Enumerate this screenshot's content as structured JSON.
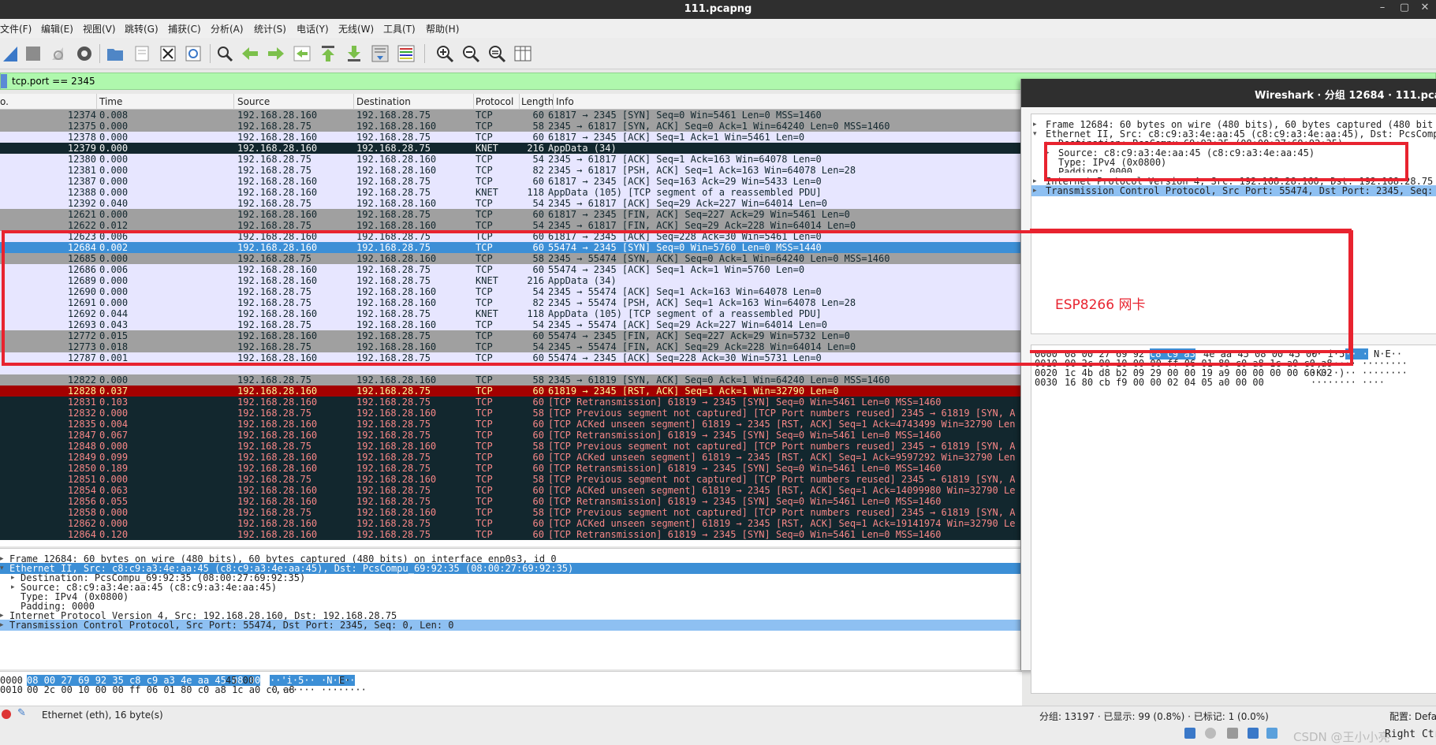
{
  "window": {
    "title": "111.pcapng"
  },
  "menu": [
    "文件(F)",
    "编辑(E)",
    "视图(V)",
    "跳转(G)",
    "捕获(C)",
    "分析(A)",
    "统计(S)",
    "电话(Y)",
    "无线(W)",
    "工具(T)",
    "帮助(H)"
  ],
  "filter": {
    "text": "tcp.port == 2345"
  },
  "columns": [
    "o.",
    "Time",
    "Source",
    "Destination",
    "Protocol",
    "Length",
    "Info"
  ],
  "colors": {
    "tcp": "#e7e6ff",
    "syn_fin": "#a0a0a0",
    "selected": "#3c8fd6",
    "knet": "#12272e",
    "error": "#a40000",
    "filter_ok": "#aff8ad",
    "annotation": "#e8232f"
  },
  "packets": [
    {
      "no": "12374",
      "time": "0.008",
      "src": "192.168.28.160",
      "dst": "192.168.28.75",
      "proto": "TCP",
      "len": "60",
      "info": "61817 → 2345 [SYN] Seq=0 Win=5461 Len=0 MSS=1460",
      "style": "gray"
    },
    {
      "no": "12375",
      "time": "0.000",
      "src": "192.168.28.75",
      "dst": "192.168.28.160",
      "proto": "TCP",
      "len": "58",
      "info": "2345 → 61817 [SYN, ACK] Seq=0 Ack=1 Win=64240 Len=0 MSS=1460",
      "style": "gray"
    },
    {
      "no": "12378",
      "time": "0.000",
      "src": "192.168.28.160",
      "dst": "192.168.28.75",
      "proto": "TCP",
      "len": "60",
      "info": "61817 → 2345 [ACK] Seq=1 Ack=1 Win=5461 Len=0",
      "style": "tcp"
    },
    {
      "no": "12379",
      "time": "0.000",
      "src": "192.168.28.160",
      "dst": "192.168.28.75",
      "proto": "KNET",
      "len": "216",
      "info": "AppData (34)",
      "style": "dark"
    },
    {
      "no": "12380",
      "time": "0.000",
      "src": "192.168.28.75",
      "dst": "192.168.28.160",
      "proto": "TCP",
      "len": "54",
      "info": "2345 → 61817 [ACK] Seq=1 Ack=163 Win=64078 Len=0",
      "style": "tcp"
    },
    {
      "no": "12381",
      "time": "0.000",
      "src": "192.168.28.75",
      "dst": "192.168.28.160",
      "proto": "TCP",
      "len": "82",
      "info": "2345 → 61817 [PSH, ACK] Seq=1 Ack=163 Win=64078 Len=28",
      "style": "tcp"
    },
    {
      "no": "12387",
      "time": "0.000",
      "src": "192.168.28.160",
      "dst": "192.168.28.75",
      "proto": "TCP",
      "len": "60",
      "info": "61817 → 2345 [ACK] Seq=163 Ack=29 Win=5433 Len=0",
      "style": "tcp"
    },
    {
      "no": "12388",
      "time": "0.000",
      "src": "192.168.28.160",
      "dst": "192.168.28.75",
      "proto": "KNET",
      "len": "118",
      "info": "AppData (105) [TCP segment of a reassembled PDU]",
      "style": "tcp"
    },
    {
      "no": "12392",
      "time": "0.040",
      "src": "192.168.28.75",
      "dst": "192.168.28.160",
      "proto": "TCP",
      "len": "54",
      "info": "2345 → 61817 [ACK] Seq=29 Ack=227 Win=64014 Len=0",
      "style": "tcp"
    },
    {
      "no": "12621",
      "time": "0.000",
      "src": "192.168.28.160",
      "dst": "192.168.28.75",
      "proto": "TCP",
      "len": "60",
      "info": "61817 → 2345 [FIN, ACK] Seq=227 Ack=29 Win=5461 Len=0",
      "style": "gray"
    },
    {
      "no": "12622",
      "time": "0.012",
      "src": "192.168.28.75",
      "dst": "192.168.28.160",
      "proto": "TCP",
      "len": "54",
      "info": "2345 → 61817 [FIN, ACK] Seq=29 Ack=228 Win=64014 Len=0",
      "style": "gray"
    },
    {
      "no": "12623",
      "time": "0.006",
      "src": "192.168.28.160",
      "dst": "192.168.28.75",
      "proto": "TCP",
      "len": "60",
      "info": "61817 → 2345 [ACK] Seq=228 Ack=30 Win=5461 Len=0",
      "style": "tcp"
    },
    {
      "no": "12684",
      "time": "0.002",
      "src": "192.168.28.160",
      "dst": "192.168.28.75",
      "proto": "TCP",
      "len": "60",
      "info": "55474 → 2345 [SYN] Seq=0 Win=5760 Len=0 MSS=1440",
      "style": "selected"
    },
    {
      "no": "12685",
      "time": "0.000",
      "src": "192.168.28.75",
      "dst": "192.168.28.160",
      "proto": "TCP",
      "len": "58",
      "info": "2345 → 55474 [SYN, ACK] Seq=0 Ack=1 Win=64240 Len=0 MSS=1460",
      "style": "gray"
    },
    {
      "no": "12686",
      "time": "0.006",
      "src": "192.168.28.160",
      "dst": "192.168.28.75",
      "proto": "TCP",
      "len": "60",
      "info": "55474 → 2345 [ACK] Seq=1 Ack=1 Win=5760 Len=0",
      "style": "tcp"
    },
    {
      "no": "12689",
      "time": "0.000",
      "src": "192.168.28.160",
      "dst": "192.168.28.75",
      "proto": "KNET",
      "len": "216",
      "info": "AppData (34)",
      "style": "tcp"
    },
    {
      "no": "12690",
      "time": "0.000",
      "src": "192.168.28.75",
      "dst": "192.168.28.160",
      "proto": "TCP",
      "len": "54",
      "info": "2345 → 55474 [ACK] Seq=1 Ack=163 Win=64078 Len=0",
      "style": "tcp"
    },
    {
      "no": "12691",
      "time": "0.000",
      "src": "192.168.28.75",
      "dst": "192.168.28.160",
      "proto": "TCP",
      "len": "82",
      "info": "2345 → 55474 [PSH, ACK] Seq=1 Ack=163 Win=64078 Len=28",
      "style": "tcp"
    },
    {
      "no": "12692",
      "time": "0.044",
      "src": "192.168.28.160",
      "dst": "192.168.28.75",
      "proto": "KNET",
      "len": "118",
      "info": "AppData (105) [TCP segment of a reassembled PDU]",
      "style": "tcp"
    },
    {
      "no": "12693",
      "time": "0.043",
      "src": "192.168.28.75",
      "dst": "192.168.28.160",
      "proto": "TCP",
      "len": "54",
      "info": "2345 → 55474 [ACK] Seq=29 Ack=227 Win=64014 Len=0",
      "style": "tcp"
    },
    {
      "no": "12772",
      "time": "0.015",
      "src": "192.168.28.160",
      "dst": "192.168.28.75",
      "proto": "TCP",
      "len": "60",
      "info": "55474 → 2345 [FIN, ACK] Seq=227 Ack=29 Win=5732 Len=0",
      "style": "gray"
    },
    {
      "no": "12773",
      "time": "0.018",
      "src": "192.168.28.75",
      "dst": "192.168.28.160",
      "proto": "TCP",
      "len": "54",
      "info": "2345 → 55474 [FIN, ACK] Seq=29 Ack=228 Win=64014 Len=0",
      "style": "gray"
    },
    {
      "no": "12787",
      "time": "0.001",
      "src": "192.168.28.160",
      "dst": "192.168.28.75",
      "proto": "TCP",
      "len": "60",
      "info": "55474 → 2345 [ACK] Seq=228 Ack=30 Win=5731 Len=0",
      "style": "tcp"
    },
    {
      "no": "",
      "time": "",
      "src": "",
      "dst": "",
      "proto": "",
      "len": "",
      "info": "",
      "style": "tcp"
    },
    {
      "no": "12822",
      "time": "0.000",
      "src": "192.168.28.75",
      "dst": "192.168.28.160",
      "proto": "TCP",
      "len": "58",
      "info": "2345 → 61819 [SYN, ACK] Seq=0 Ack=1 Win=64240 Len=0 MSS=1460",
      "style": "gray"
    },
    {
      "no": "12828",
      "time": "0.037",
      "src": "192.168.28.160",
      "dst": "192.168.28.75",
      "proto": "TCP",
      "len": "60",
      "info": "61819 → 2345 [RST, ACK] Seq=1 Ack=1 Win=32790 Len=0",
      "style": "error"
    },
    {
      "no": "12831",
      "time": "0.103",
      "src": "192.168.28.160",
      "dst": "192.168.28.75",
      "proto": "TCP",
      "len": "60",
      "info": "[TCP Retransmission] 61819 → 2345 [SYN] Seq=0 Win=5461 Len=0 MSS=1460",
      "style": "dark"
    },
    {
      "no": "12832",
      "time": "0.000",
      "src": "192.168.28.75",
      "dst": "192.168.28.160",
      "proto": "TCP",
      "len": "58",
      "info": "[TCP Previous segment not captured] [TCP Port numbers reused] 2345 → 61819 [SYN, A",
      "style": "dark"
    },
    {
      "no": "12835",
      "time": "0.004",
      "src": "192.168.28.160",
      "dst": "192.168.28.75",
      "proto": "TCP",
      "len": "60",
      "info": "[TCP ACKed unseen segment] 61819 → 2345 [RST, ACK] Seq=1 Ack=4743499 Win=32790 Len",
      "style": "dark"
    },
    {
      "no": "12847",
      "time": "0.067",
      "src": "192.168.28.160",
      "dst": "192.168.28.75",
      "proto": "TCP",
      "len": "60",
      "info": "[TCP Retransmission] 61819 → 2345 [SYN] Seq=0 Win=5461 Len=0 MSS=1460",
      "style": "dark"
    },
    {
      "no": "12848",
      "time": "0.000",
      "src": "192.168.28.75",
      "dst": "192.168.28.160",
      "proto": "TCP",
      "len": "58",
      "info": "[TCP Previous segment not captured] [TCP Port numbers reused] 2345 → 61819 [SYN, A",
      "style": "dark"
    },
    {
      "no": "12849",
      "time": "0.099",
      "src": "192.168.28.160",
      "dst": "192.168.28.75",
      "proto": "TCP",
      "len": "60",
      "info": "[TCP ACKed unseen segment] 61819 → 2345 [RST, ACK] Seq=1 Ack=9597292 Win=32790 Len",
      "style": "dark"
    },
    {
      "no": "12850",
      "time": "0.189",
      "src": "192.168.28.160",
      "dst": "192.168.28.75",
      "proto": "TCP",
      "len": "60",
      "info": "[TCP Retransmission] 61819 → 2345 [SYN] Seq=0 Win=5461 Len=0 MSS=1460",
      "style": "dark"
    },
    {
      "no": "12851",
      "time": "0.000",
      "src": "192.168.28.75",
      "dst": "192.168.28.160",
      "proto": "TCP",
      "len": "58",
      "info": "[TCP Previous segment not captured] [TCP Port numbers reused] 2345 → 61819 [SYN, A",
      "style": "dark"
    },
    {
      "no": "12854",
      "time": "0.063",
      "src": "192.168.28.160",
      "dst": "192.168.28.75",
      "proto": "TCP",
      "len": "60",
      "info": "[TCP ACKed unseen segment] 61819 → 2345 [RST, ACK] Seq=1 Ack=14099980 Win=32790 Le",
      "style": "dark"
    },
    {
      "no": "12856",
      "time": "0.055",
      "src": "192.168.28.160",
      "dst": "192.168.28.75",
      "proto": "TCP",
      "len": "60",
      "info": "[TCP Retransmission] 61819 → 2345 [SYN] Seq=0 Win=5461 Len=0 MSS=1460",
      "style": "dark"
    },
    {
      "no": "12858",
      "time": "0.000",
      "src": "192.168.28.75",
      "dst": "192.168.28.160",
      "proto": "TCP",
      "len": "58",
      "info": "[TCP Previous segment not captured] [TCP Port numbers reused] 2345 → 61819 [SYN, A",
      "style": "dark"
    },
    {
      "no": "12862",
      "time": "0.000",
      "src": "192.168.28.160",
      "dst": "192.168.28.75",
      "proto": "TCP",
      "len": "60",
      "info": "[TCP ACKed unseen segment] 61819 → 2345 [RST, ACK] Seq=1 Ack=19141974 Win=32790 Le",
      "style": "dark"
    },
    {
      "no": "12864",
      "time": "0.120",
      "src": "192.168.28.160",
      "dst": "192.168.28.75",
      "proto": "TCP",
      "len": "60",
      "info": "[TCP Retransmission] 61819 → 2345 [SYN] Seq=0 Win=5461 Len=0 MSS=1460",
      "style": "dark"
    }
  ],
  "details": [
    {
      "text": "Frame 12684: 60 bytes on wire (480 bits), 60 bytes captured (480 bits) on interface enp0s3, id 0",
      "indent": 0,
      "arrow": "▸",
      "style": ""
    },
    {
      "text": "Ethernet II, Src: c8:c9:a3:4e:aa:45 (c8:c9:a3:4e:aa:45), Dst: PcsCompu_69:92:35 (08:00:27:69:92:35)",
      "indent": 0,
      "arrow": "▾",
      "style": "selected"
    },
    {
      "text": "Destination: PcsCompu_69:92:35 (08:00:27:69:92:35)",
      "indent": 1,
      "arrow": "▸",
      "style": ""
    },
    {
      "text": "Source: c8:c9:a3:4e:aa:45 (c8:c9:a3:4e:aa:45)",
      "indent": 1,
      "arrow": "▸",
      "style": ""
    },
    {
      "text": "Type: IPv4 (0x0800)",
      "indent": 1,
      "arrow": "",
      "style": ""
    },
    {
      "text": "Padding: 0000",
      "indent": 1,
      "arrow": "",
      "style": ""
    },
    {
      "text": "Internet Protocol Version 4, Src: 192.168.28.160, Dst: 192.168.28.75",
      "indent": 0,
      "arrow": "▸",
      "style": ""
    },
    {
      "text": "Transmission Control Protocol, Src Port: 55474, Dst Port: 2345, Seq: 0, Len: 0",
      "indent": 0,
      "arrow": "▸",
      "style": "light"
    }
  ],
  "bytes": [
    {
      "off": "0000",
      "hex_sel": "08 00 27 69 92 35 c8 c9  a3 4e aa 45 08 00",
      "hex_rest": " 45 00",
      "ascii_sel": "··'i·5·· ·N·E··",
      "ascii_rest": "E·"
    },
    {
      "off": "0010",
      "hex_sel": "",
      "hex_rest": "00 2c 00 10 00 00 ff 06  01 80 c0 a8 1c a0 c0 a8",
      "ascii_sel": "",
      "ascii_rest": "·,······ ········"
    }
  ],
  "status": {
    "left": "Ethernet (eth), 16 byte(s)",
    "right": "分组: 13197 · 已显示: 99 (0.8%) · 已标记: 1 (0.0%)",
    "profile": "配置: Defau",
    "watermark": "CSDN @王小小亮",
    "right_ctrl": "Right Ctr"
  },
  "popup": {
    "title": "Wireshark · 分组 12684 · 111.pcap",
    "tree": [
      {
        "text": "Frame 12684: 60 bytes on wire (480 bits), 60 bytes captured (480 bit",
        "indent": 0,
        "arrow": "▸",
        "style": ""
      },
      {
        "text": "Ethernet II, Src: c8:c9:a3:4e:aa:45 (c8:c9:a3:4e:aa:45), Dst: PcsComp",
        "indent": 0,
        "arrow": "▾",
        "style": ""
      },
      {
        "text": "Destination: PcsCompu_69:92:35 (08:00:27:69:92:35)",
        "indent": 1,
        "arrow": "▸",
        "style": "clip"
      },
      {
        "text": "Source: c8:c9:a3:4e:aa:45 (c8:c9:a3:4e:aa:45)",
        "indent": 1,
        "arrow": "▸",
        "style": ""
      },
      {
        "text": "Type: IPv4 (0x0800)",
        "indent": 1,
        "arrow": "",
        "style": ""
      },
      {
        "text": "Padding: 0000",
        "indent": 1,
        "arrow": "",
        "style": "clip"
      },
      {
        "text": "Internet Protocol Version 4, Src: 192.168.28.160, Dst: 192.168.28.75",
        "indent": 0,
        "arrow": "▸",
        "style": ""
      },
      {
        "text": "Transmission Control Protocol, Src Port: 55474, Dst Port: 2345, Seq:",
        "indent": 0,
        "arrow": "▸",
        "style": "light"
      }
    ],
    "hex": [
      {
        "off": "0000",
        "pre": "08 00 27 69 92 35 ",
        "sel": "c8 c9  a3",
        "post": " 4e aa 45 08 00 45 00",
        "ascii_pre": "··'i·5",
        "ascii_sel": "·· ·",
        "ascii_post": "N·E··"
      },
      {
        "off": "0010",
        "pre": "00 2c 00 10 00 00 ff 06  01 80 c0 a8 1c a0 c0 a8",
        "sel": "",
        "post": "",
        "ascii_pre": "·,······ ········",
        "ascii_sel": "",
        "ascii_post": ""
      },
      {
        "off": "0020",
        "pre": "1c 4b d8 b2 09 29 00 00  19 a9 00 00 00 00 60 02",
        "sel": "",
        "post": "",
        "ascii_pre": "·K···)·· ········",
        "ascii_sel": "",
        "ascii_post": ""
      },
      {
        "off": "0030",
        "pre": "16 80 cb f9 00 00 02 04  05 a0 00 00",
        "sel": "",
        "post": "",
        "ascii_pre": "········ ····",
        "ascii_sel": "",
        "ascii_post": ""
      }
    ]
  },
  "annotation": {
    "label": "ESP8266 网卡"
  }
}
